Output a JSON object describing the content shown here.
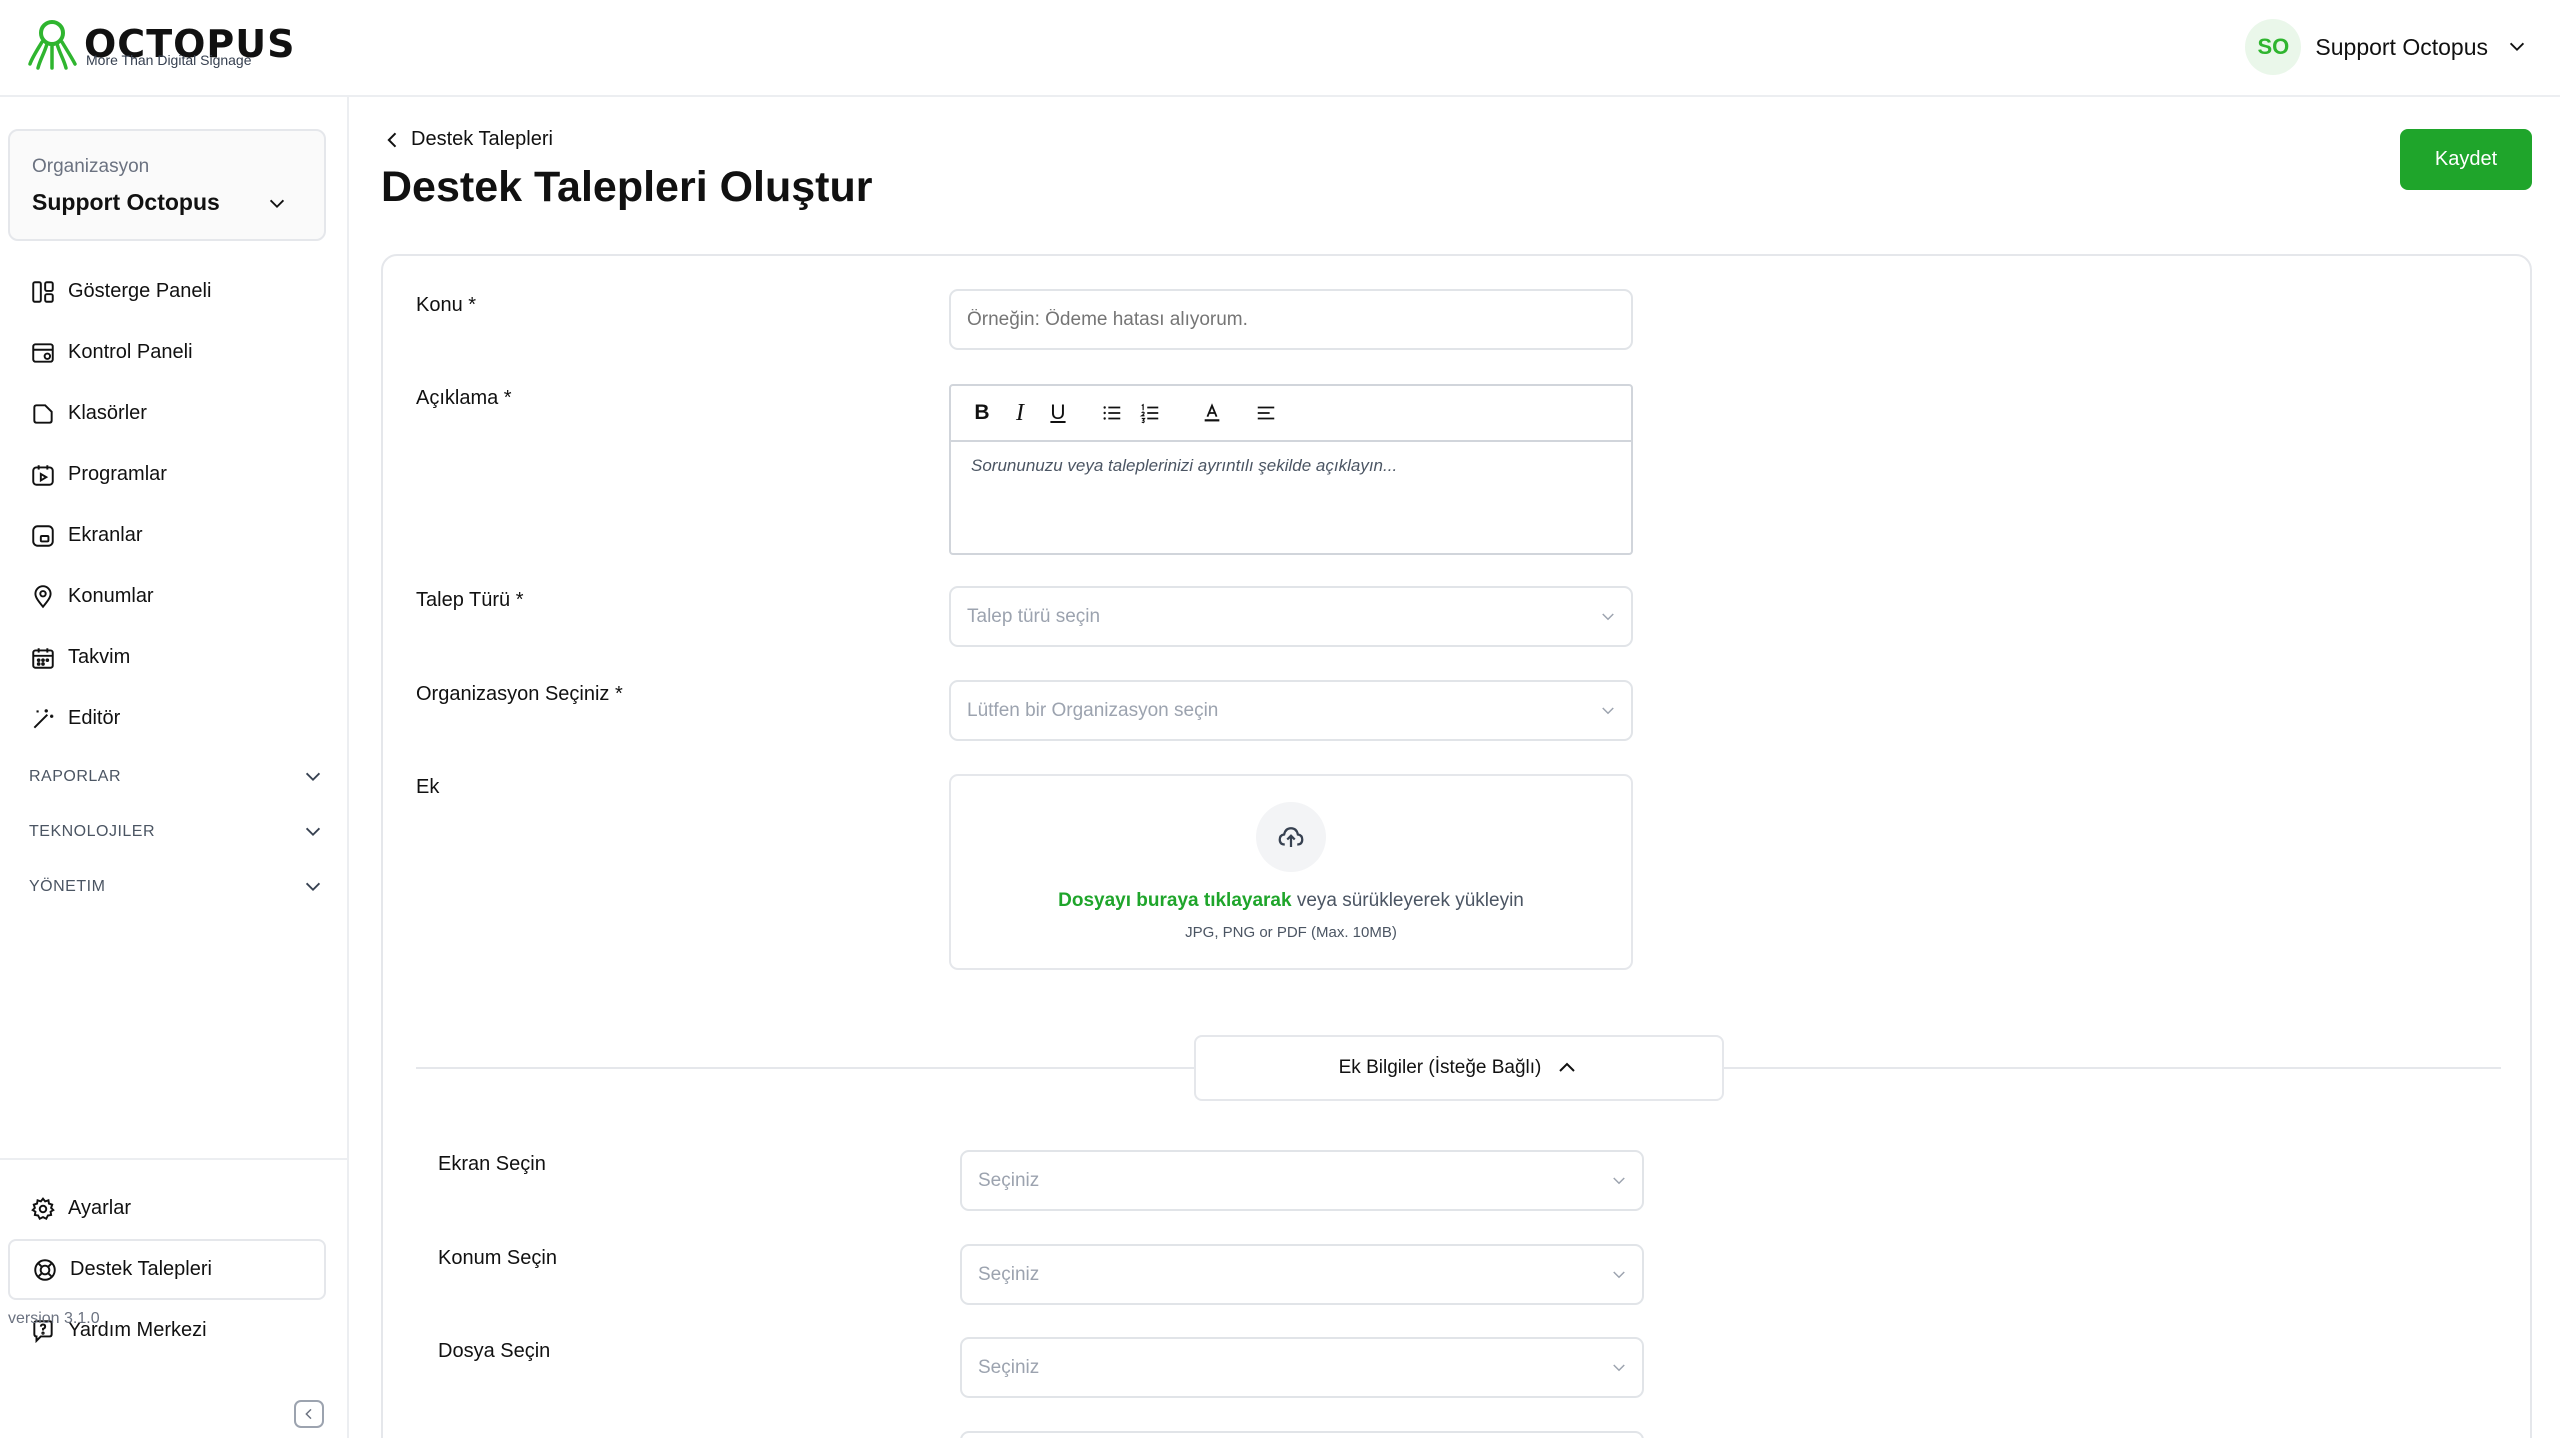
{
  "header": {
    "brand": "OCTOPUS",
    "tagline": "More Than Digital Signage",
    "avatar_initials": "SO",
    "user_name": "Support Octopus"
  },
  "sidebar": {
    "org_label": "Organizasyon",
    "org_value": "Support Octopus",
    "items": [
      {
        "label": "Gösterge Paneli",
        "icon": "dashboard-icon"
      },
      {
        "label": "Kontrol Paneli",
        "icon": "control-panel-icon"
      },
      {
        "label": "Klasörler",
        "icon": "folder-icon"
      },
      {
        "label": "Programlar",
        "icon": "program-icon"
      },
      {
        "label": "Ekranlar",
        "icon": "screen-icon"
      },
      {
        "label": "Konumlar",
        "icon": "location-icon"
      },
      {
        "label": "Takvim",
        "icon": "calendar-icon"
      },
      {
        "label": "Editör",
        "icon": "magic-wand-icon"
      }
    ],
    "sections": [
      "RAPORLAR",
      "TEKNOLOJILER",
      "YÖNETIM"
    ],
    "bottom_items": [
      {
        "label": "Ayarlar",
        "icon": "gear-icon"
      },
      {
        "label": "Destek Talepleri",
        "icon": "lifebuoy-icon",
        "active": true
      },
      {
        "label": "Yardım Merkezi",
        "icon": "help-icon"
      }
    ],
    "version": "version 3.1.0"
  },
  "page": {
    "back_label": "Destek Talepleri",
    "title": "Destek Talepleri Oluştur",
    "save_label": "Kaydet"
  },
  "form": {
    "subject": {
      "label": "Konu *",
      "placeholder": "Örneğin: Ödeme hatası alıyorum."
    },
    "description": {
      "label": "Açıklama *",
      "placeholder": "Sorununuzu veya taleplerinizi ayrıntılı şekilde açıklayın..."
    },
    "request_type": {
      "label": "Talep Türü *",
      "placeholder": "Talep türü seçin"
    },
    "organization": {
      "label": "Organizasyon Seçiniz *",
      "placeholder": "Lütfen bir Organizasyon seçin"
    },
    "attachment": {
      "label": "Ek",
      "link_text": "Dosyayı buraya tıklayarak",
      "rest_text": " veya sürükleyerek yükleyin",
      "hint": "JPG, PNG or PDF (Max. 10MB)"
    },
    "extra_toggle": "Ek Bilgiler (İsteğe Bağlı)",
    "extra_fields": [
      {
        "label": "Ekran Seçin",
        "placeholder": "Seçiniz"
      },
      {
        "label": "Konum Seçin",
        "placeholder": "Seçiniz"
      },
      {
        "label": "Dosya Seçin",
        "placeholder": "Seçiniz"
      }
    ]
  },
  "colors": {
    "accent": "#1fa52b",
    "avatar_bg": "#eaf7ea"
  }
}
